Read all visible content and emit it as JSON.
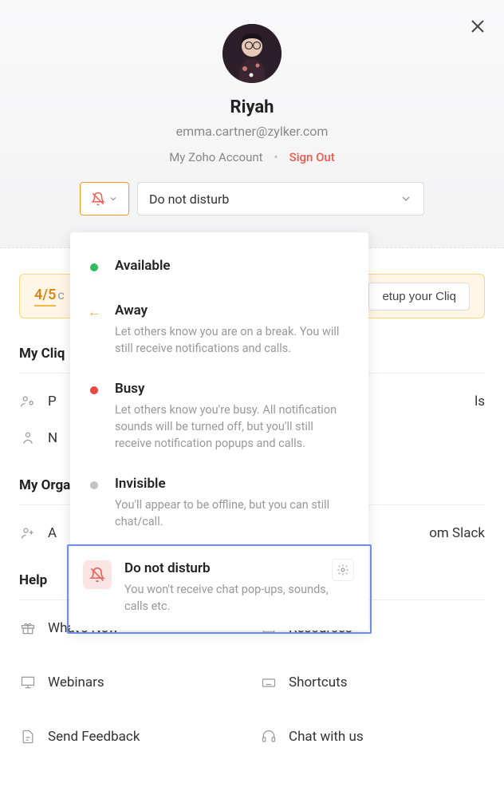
{
  "user": {
    "name": "Riyah",
    "email": "emma.cartner@zylker.com"
  },
  "account_links": {
    "my_account": "My Zoho Account",
    "sign_out": "Sign Out"
  },
  "status": {
    "selected": "Do not disturb"
  },
  "banner": {
    "count": "4/5",
    "context": "c",
    "button": "etup your Cliq"
  },
  "sections": {
    "my_cliq": "My Cliq",
    "my_org": "My Orga",
    "help": "Help"
  },
  "my_cliq_items": {
    "item1": "P",
    "item1_right": "ls",
    "item2": "N"
  },
  "my_org_items": {
    "item1": "A",
    "item1_right": "om Slack"
  },
  "help_items": {
    "whats_new": "What's New",
    "resources": "Resources",
    "webinars": "Webinars",
    "shortcuts": "Shortcuts",
    "feedback": "Send Feedback",
    "chat": "Chat with us"
  },
  "status_options": {
    "available": {
      "label": "Available"
    },
    "away": {
      "label": "Away",
      "desc": "Let others know you are on a break. You will still receive notifications and calls."
    },
    "busy": {
      "label": "Busy",
      "desc": "Let others know you're busy. All notification sounds will be turned off, but you'll still receive notification popups and calls."
    },
    "invisible": {
      "label": "Invisible",
      "desc": "You'll appear to be offline, but you can still chat/call."
    },
    "dnd": {
      "label": "Do not disturb",
      "desc": "You won't receive chat pop-ups, sounds, calls etc."
    }
  }
}
